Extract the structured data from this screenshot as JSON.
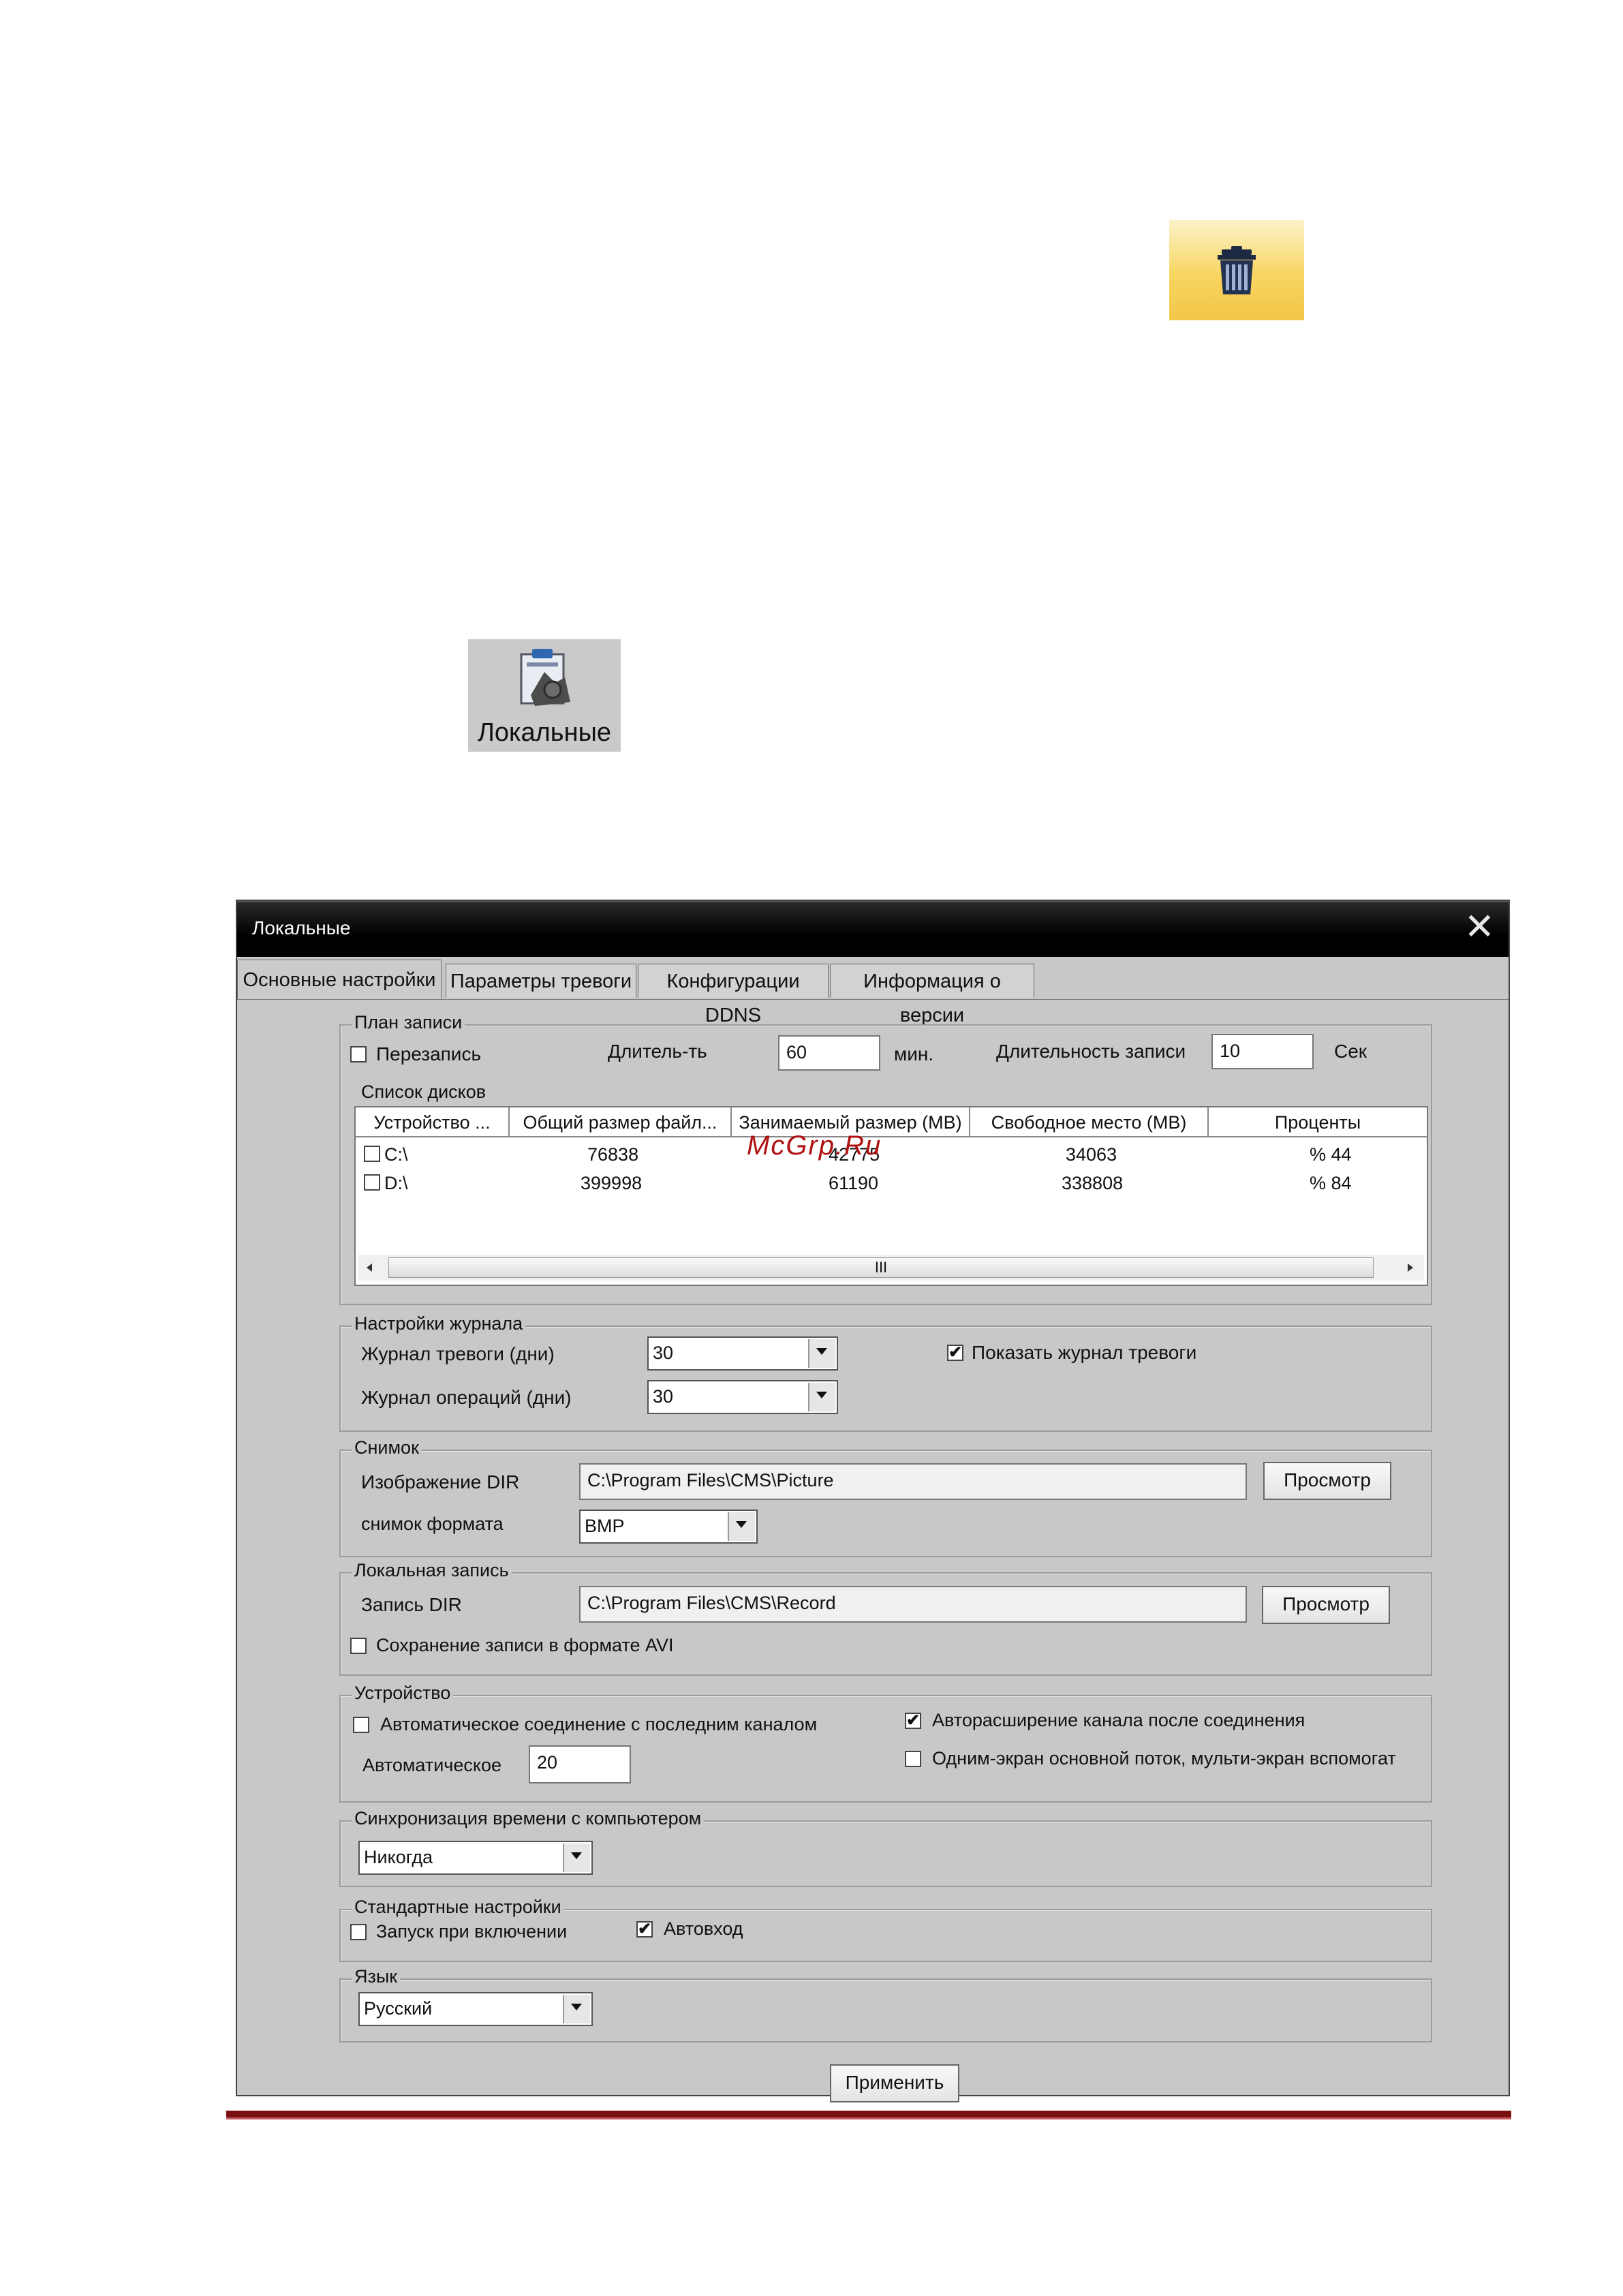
{
  "icons": {
    "trash": "trash-icon",
    "local_settings": "local-settings-icon",
    "local_settings_label": "Локальные"
  },
  "dialog": {
    "title": "Локальные",
    "tabs": [
      "Основные настройки",
      "Параметры тревоги",
      "Конфигурации DDNS",
      "Информация о версии"
    ],
    "active_tab": 0,
    "record_plan": {
      "label": "План записи",
      "overwrite_label": "Перезапись",
      "overwrite_checked": false,
      "duration_label": "Длитель-ть",
      "duration_value": "60",
      "duration_unit": "мин.",
      "record_duration_label": "Длительность записи",
      "record_duration_value": "10",
      "record_duration_unit": "Сек",
      "disk_list_label": "Список дисков",
      "columns": [
        "Устройство ...",
        "Общий размер файл...",
        "Занимаемый размер (MB)",
        "Свободное место (MB)",
        "Проценты"
      ],
      "rows": [
        {
          "device": "C:\\",
          "total": "76838",
          "used": "42775",
          "free": "34063",
          "percent": "% 44",
          "checked": false
        },
        {
          "device": "D:\\",
          "total": "399998",
          "used": "61190",
          "free": "338808",
          "percent": "% 84",
          "checked": false
        }
      ],
      "scroll_glyph": "III"
    },
    "log_settings": {
      "label": "Настройки журнала",
      "alarm_log_label": "Журнал тревоги (дни)",
      "alarm_log_value": "30",
      "operation_log_label": "Журнал операций (дни)",
      "operation_log_value": "30",
      "show_alarm_log_label": "Показать журнал тревоги",
      "show_alarm_log_checked": true
    },
    "snapshot": {
      "label": "Снимок",
      "dir_label": "Изображение DIR",
      "dir_value": "C:\\Program Files\\CMS\\Picture",
      "browse_label": "Просмотр",
      "format_label": "снимок формата",
      "format_value": "BMP"
    },
    "local_record": {
      "label": "Локальная запись",
      "dir_label": "Запись DIR",
      "dir_value": "C:\\Program Files\\CMS\\Record",
      "browse_label": "Просмотр",
      "avi_label": "Сохранение записи в формате AVI",
      "avi_checked": false
    },
    "device": {
      "label": "Устройство",
      "auto_connect_label": "Автоматическое соединение с последним каналом",
      "auto_connect_checked": false,
      "auto_expand_label": "Авторасширение канала после соединения",
      "auto_expand_checked": true,
      "auto_label": "Автоматическое",
      "auto_value": "20",
      "single_screen_label": "Одним-экран основной поток, мульти-экран вспомогат",
      "single_screen_checked": false
    },
    "time_sync": {
      "label": "Синхронизация времени с компьютером",
      "value": "Никогда"
    },
    "default_settings": {
      "label": "Стандартные настройки",
      "startup_label": "Запуск при включении",
      "startup_checked": false,
      "autologin_label": "Автовход",
      "autologin_checked": true
    },
    "language": {
      "label": "Язык",
      "value": "Русский"
    },
    "apply_label": "Применить",
    "close_glyph": "✕",
    "check_glyph": "✔"
  },
  "watermark": "McGrp.Ru"
}
